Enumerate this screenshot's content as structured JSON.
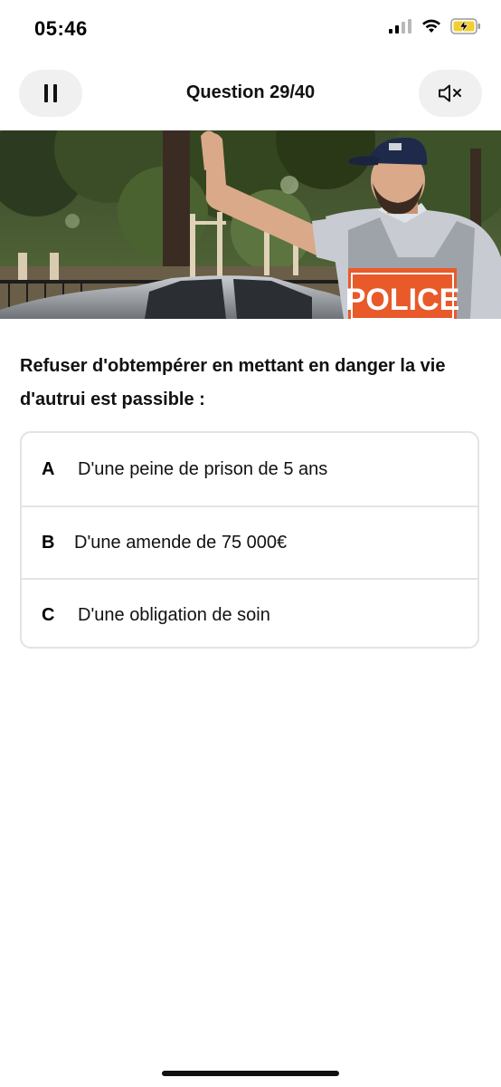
{
  "status_bar": {
    "time": "05:46"
  },
  "header": {
    "title": "Question 29/40",
    "pause_icon": "pause-icon",
    "mute_icon": "speaker-muted-icon"
  },
  "photo": {
    "vest_text": "POLICE"
  },
  "question": {
    "text": "Refuser d'obtempérer en mettant en danger la vie d'autrui est passible :"
  },
  "answers": [
    {
      "letter": "A",
      "text": "D'une peine de prison de 5 ans"
    },
    {
      "letter": "B",
      "text": "D'une amende de 75 000€"
    },
    {
      "letter": "C",
      "text": "D'une obligation de soin"
    }
  ],
  "colors": {
    "button_bg": "#f0f0f0",
    "border": "#e3e3e3",
    "battery_accent": "#f2cf2f"
  }
}
